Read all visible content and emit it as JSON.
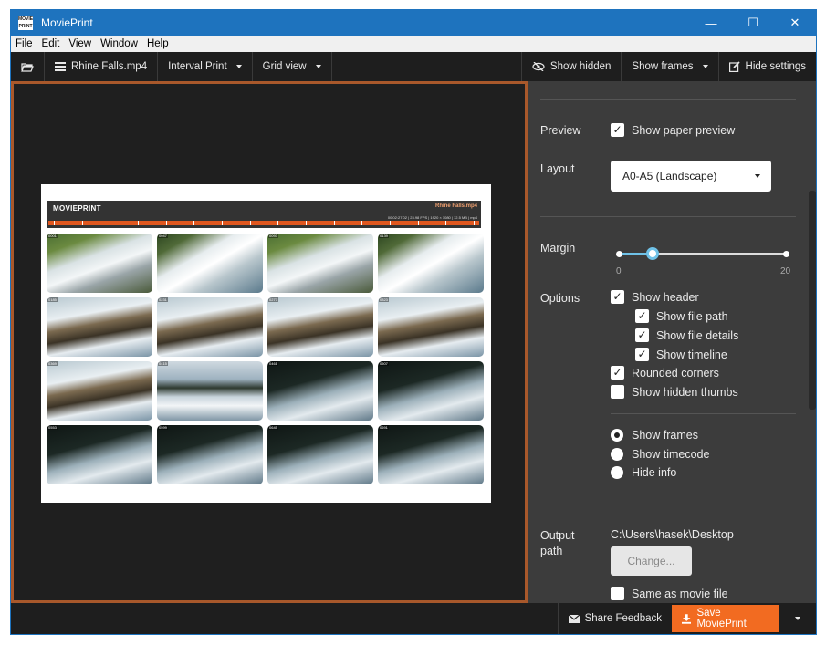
{
  "window": {
    "title": "MoviePrint",
    "logo_text": "MOVIE PRINT",
    "minimize_glyph": "—",
    "maximize_glyph": "☐",
    "close_glyph": "✕"
  },
  "menu": [
    "File",
    "Edit",
    "View",
    "Window",
    "Help"
  ],
  "toolbar": {
    "file_label": "Rhine Falls.mp4",
    "interval_label": "Interval Print",
    "view_label": "Grid view",
    "show_hidden_label": "Show hidden",
    "show_frames_label": "Show frames",
    "hide_settings_label": "Hide settings"
  },
  "movieprint": {
    "brand": "MOVIEPRINT",
    "file_name": "Rhine Falls.mp4",
    "file_details": "00:02:27:02 | 23.98 FPS | 1920 × 1080 | 12.5 MB | mp4",
    "timeline_ticks": 16,
    "frames": [
      "0001",
      "0047",
      "0093",
      "0139",
      "0185",
      "0231",
      "0277",
      "0323",
      "0369",
      "0415",
      "0461",
      "0507",
      "0553",
      "0599",
      "0645",
      "0691"
    ]
  },
  "settings": {
    "preview_label": "Preview",
    "show_paper_preview": "Show paper preview",
    "layout_label": "Layout",
    "layout_value": "A0-A5 (Landscape)",
    "margin_label": "Margin",
    "margin_min": "0",
    "margin_max": "20",
    "margin_value": 4,
    "options_label": "Options",
    "show_header": "Show header",
    "show_file_path": "Show file path",
    "show_file_details": "Show file details",
    "show_timeline": "Show timeline",
    "rounded_corners": "Rounded corners",
    "show_hidden_thumbs": "Show hidden thumbs",
    "radio_show_frames": "Show frames",
    "radio_show_timecode": "Show timecode",
    "radio_hide_info": "Hide info",
    "output_label_1": "Output",
    "output_label_2": "path",
    "output_path": "C:\\Users\\hasek\\Desktop",
    "change_button": "Change...",
    "same_as_movie": "Same as movie file",
    "check_glyph": "✓"
  },
  "footer": {
    "share_label": "Share Feedback",
    "save_label": "Save MoviePrint"
  },
  "colors": {
    "accent": "#f26b21",
    "frame_border": "#a8582b",
    "titlebar": "#1e73be",
    "slider": "#6fc2e8"
  }
}
